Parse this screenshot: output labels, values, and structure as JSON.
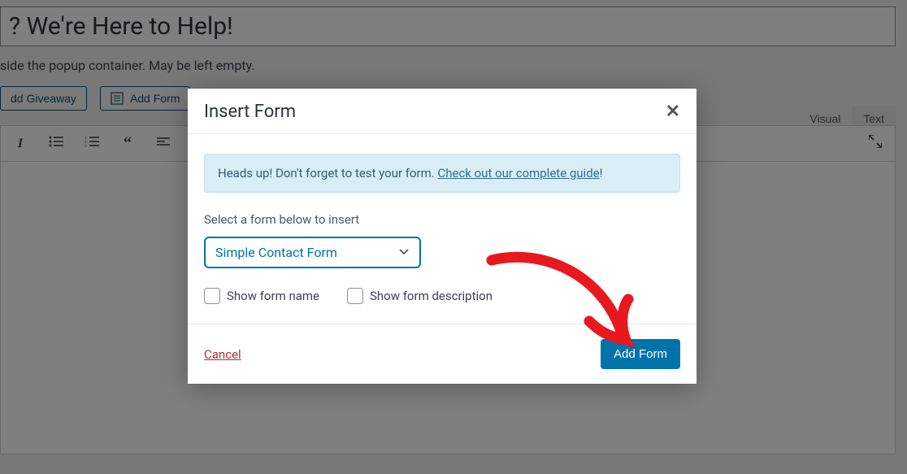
{
  "editor": {
    "title_value": "? We're Here to Help!",
    "hint": "side the popup container. May be left empty.",
    "add_giveaway_label": "dd Giveaway",
    "add_form_label": "Add Form",
    "tabs": {
      "visual": "Visual",
      "text": "Text"
    }
  },
  "modal": {
    "title": "Insert Form",
    "alert_prefix": "Heads up! Don't forget to test your form. ",
    "alert_link": "Check out our complete guide",
    "alert_suffix": "!",
    "select_label": "Select a form below to insert",
    "selected_form": "Simple Contact Form",
    "show_name_label": "Show form name",
    "show_desc_label": "Show form description",
    "cancel_label": "Cancel",
    "add_label": "Add Form"
  }
}
